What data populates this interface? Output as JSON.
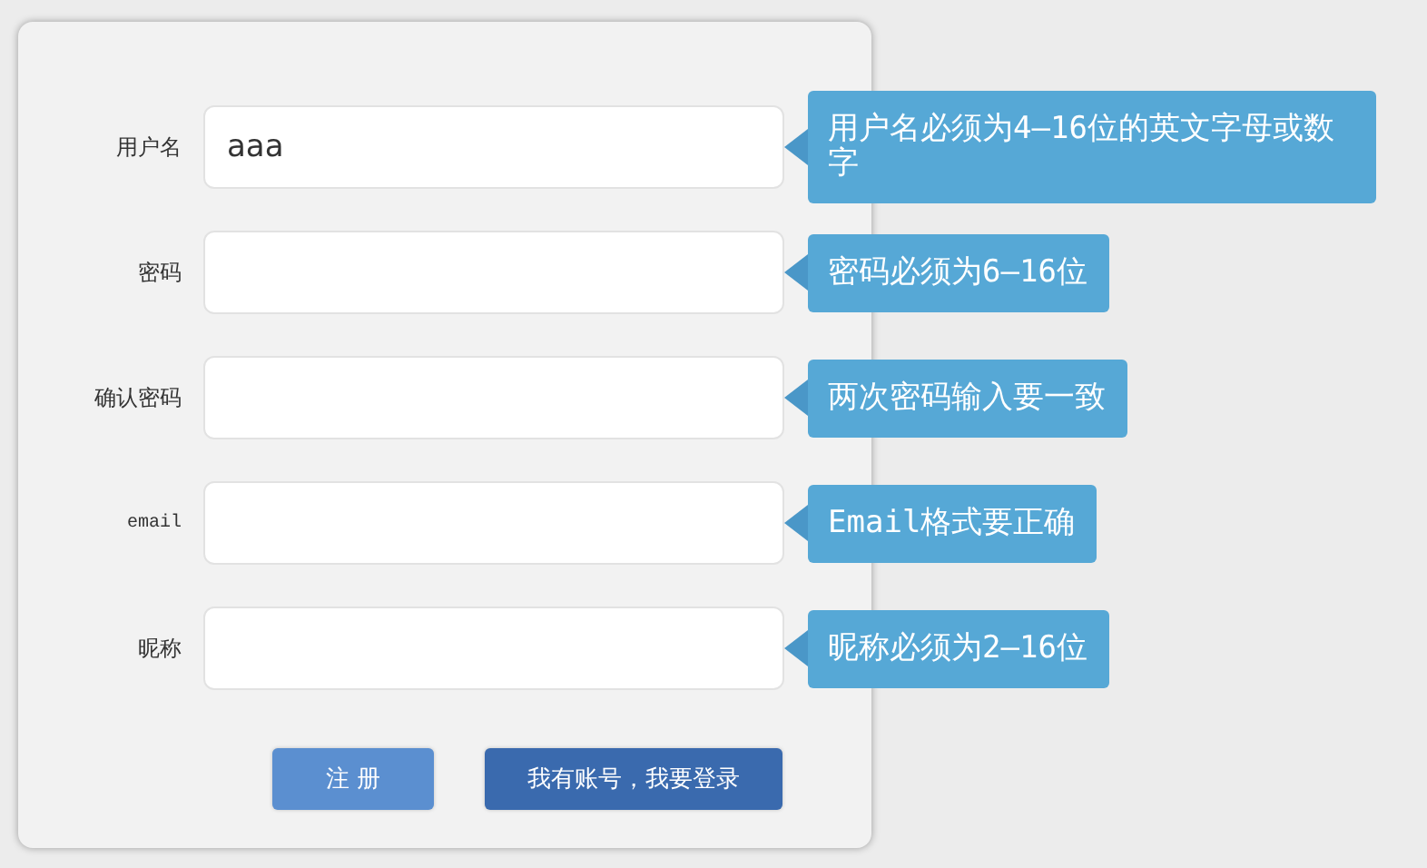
{
  "fields": [
    {
      "label": "用户名",
      "kind": "text",
      "value": "aaa",
      "hint": "用户名必须为4—16位的英文字母或数字"
    },
    {
      "label": "密码",
      "kind": "password",
      "hint": "密码必须为6—16位"
    },
    {
      "label": "确认密码",
      "kind": "password",
      "hint": "两次密码输入要一致"
    },
    {
      "label": "email",
      "kind": "email",
      "hint": "Email格式要正确"
    },
    {
      "label": "昵称",
      "kind": "text",
      "hint": "昵称必须为2—16位"
    }
  ],
  "buttons": [
    {
      "label": "注 册",
      "kind": "primary"
    },
    {
      "label": "我有账号，我要登录",
      "kind": "secondary"
    }
  ]
}
